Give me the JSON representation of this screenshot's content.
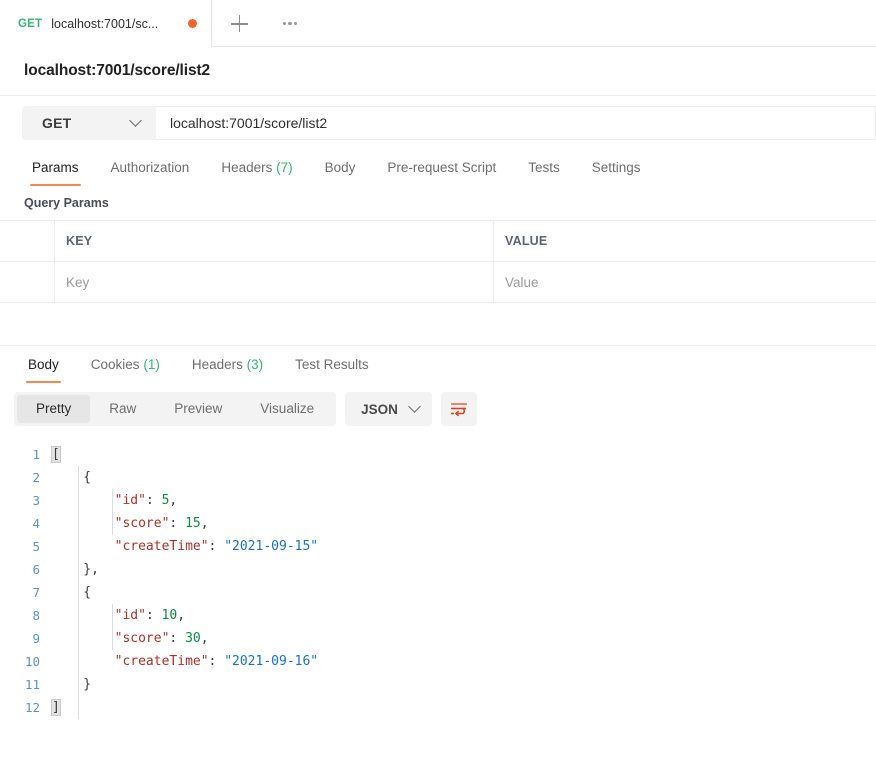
{
  "tabstrip": {
    "tab": {
      "method": "GET",
      "title": "localhost:7001/sc...",
      "unsaved": true
    },
    "add_label": "+",
    "more_label": "•••"
  },
  "request": {
    "name": "localhost:7001/score/list2",
    "method": "GET",
    "url": "localhost:7001/score/list2",
    "tabs": [
      {
        "label": "Params",
        "count": "",
        "active": true
      },
      {
        "label": "Authorization",
        "count": "",
        "active": false
      },
      {
        "label": "Headers",
        "count": "(7)",
        "active": false
      },
      {
        "label": "Body",
        "count": "",
        "active": false
      },
      {
        "label": "Pre-request Script",
        "count": "",
        "active": false
      },
      {
        "label": "Tests",
        "count": "",
        "active": false
      },
      {
        "label": "Settings",
        "count": "",
        "active": false
      }
    ]
  },
  "query_params": {
    "title": "Query Params",
    "columns": {
      "key": "KEY",
      "value": "VALUE"
    },
    "empty_row": {
      "key_placeholder": "Key",
      "value_placeholder": "Value"
    }
  },
  "response": {
    "tabs": [
      {
        "label": "Body",
        "count": "",
        "active": true
      },
      {
        "label": "Cookies",
        "count": "(1)",
        "active": false
      },
      {
        "label": "Headers",
        "count": "(3)",
        "active": false
      },
      {
        "label": "Test Results",
        "count": "",
        "active": false
      }
    ],
    "format": {
      "segments": [
        {
          "label": "Pretty",
          "active": true
        },
        {
          "label": "Raw",
          "active": false
        },
        {
          "label": "Preview",
          "active": false
        },
        {
          "label": "Visualize",
          "active": false
        }
      ],
      "language": "JSON",
      "wrap_icon": "word-wrap-icon"
    },
    "body_lines": [
      {
        "n": "1",
        "segments": [
          {
            "t": "[",
            "c": "brace hl"
          }
        ]
      },
      {
        "n": "2",
        "segments": [
          {
            "t": "    {",
            "c": "brace"
          }
        ]
      },
      {
        "n": "3",
        "segments": [
          {
            "t": "        ",
            "c": "pun"
          },
          {
            "t": "\"id\"",
            "c": "key"
          },
          {
            "t": ": ",
            "c": "pun"
          },
          {
            "t": "5",
            "c": "num"
          },
          {
            "t": ",",
            "c": "pun"
          }
        ]
      },
      {
        "n": "4",
        "segments": [
          {
            "t": "        ",
            "c": "pun"
          },
          {
            "t": "\"score\"",
            "c": "key"
          },
          {
            "t": ": ",
            "c": "pun"
          },
          {
            "t": "15",
            "c": "num"
          },
          {
            "t": ",",
            "c": "pun"
          }
        ]
      },
      {
        "n": "5",
        "segments": [
          {
            "t": "        ",
            "c": "pun"
          },
          {
            "t": "\"createTime\"",
            "c": "key"
          },
          {
            "t": ": ",
            "c": "pun"
          },
          {
            "t": "\"2021-09-15\"",
            "c": "str"
          }
        ]
      },
      {
        "n": "6",
        "segments": [
          {
            "t": "    },",
            "c": "brace"
          }
        ]
      },
      {
        "n": "7",
        "segments": [
          {
            "t": "    {",
            "c": "brace"
          }
        ]
      },
      {
        "n": "8",
        "segments": [
          {
            "t": "        ",
            "c": "pun"
          },
          {
            "t": "\"id\"",
            "c": "key"
          },
          {
            "t": ": ",
            "c": "pun"
          },
          {
            "t": "10",
            "c": "num"
          },
          {
            "t": ",",
            "c": "pun"
          }
        ]
      },
      {
        "n": "9",
        "segments": [
          {
            "t": "        ",
            "c": "pun"
          },
          {
            "t": "\"score\"",
            "c": "key"
          },
          {
            "t": ": ",
            "c": "pun"
          },
          {
            "t": "30",
            "c": "num"
          },
          {
            "t": ",",
            "c": "pun"
          }
        ]
      },
      {
        "n": "10",
        "segments": [
          {
            "t": "        ",
            "c": "pun"
          },
          {
            "t": "\"createTime\"",
            "c": "key"
          },
          {
            "t": ": ",
            "c": "pun"
          },
          {
            "t": "\"2021-09-16\"",
            "c": "str"
          }
        ]
      },
      {
        "n": "11",
        "segments": [
          {
            "t": "    }",
            "c": "brace"
          }
        ]
      },
      {
        "n": "12",
        "segments": [
          {
            "t": "]",
            "c": "brace hl"
          }
        ]
      }
    ],
    "parsed_json": [
      {
        "id": 5,
        "score": 15,
        "createTime": "2021-09-15"
      },
      {
        "id": 10,
        "score": 30,
        "createTime": "2021-09-16"
      }
    ]
  },
  "colors": {
    "accent_orange": "#f4864e",
    "unsaved_dot": "#f4622c",
    "method_green": "#3cb179",
    "count_green": "#35b36e",
    "json_key": "#a6332c",
    "json_string": "#1b6fc0",
    "json_number": "#0b8a43",
    "line_number": "#5d94bb"
  }
}
